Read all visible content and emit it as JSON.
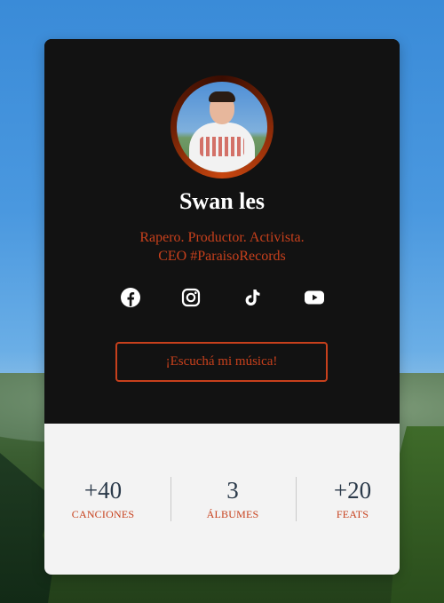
{
  "profile": {
    "name": "Swan les",
    "bio_line1": "Rapero. Productor. Activista.",
    "bio_line2": "CEO #ParaisoRecords"
  },
  "socials": [
    {
      "icon": "facebook-icon"
    },
    {
      "icon": "instagram-icon"
    },
    {
      "icon": "tiktok-icon"
    },
    {
      "icon": "youtube-icon"
    }
  ],
  "cta": {
    "label": "¡Escuchá mi música!"
  },
  "stats": [
    {
      "value": "+40",
      "label": "CANCIONES"
    },
    {
      "value": "3",
      "label": "ÁLBUMES"
    },
    {
      "value": "+20",
      "label": "FEATS"
    }
  ],
  "colors": {
    "accent": "#c7401c",
    "card_dark": "#121212",
    "card_light": "#f3f3f3",
    "stat_value": "#2b3a4a"
  }
}
